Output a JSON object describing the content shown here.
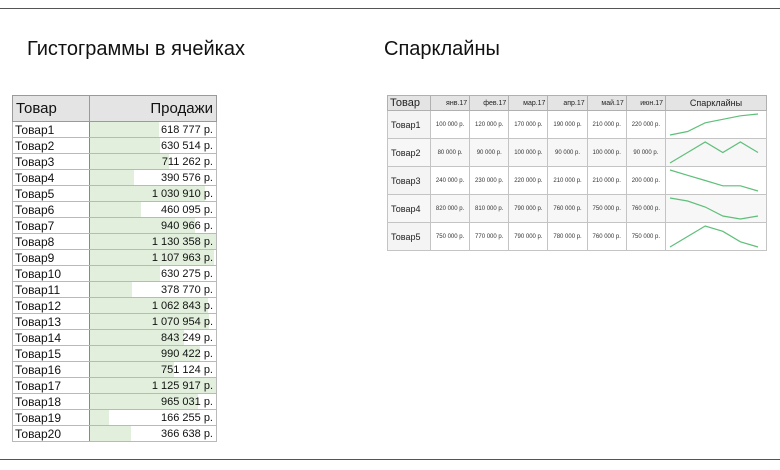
{
  "headings": {
    "left": "Гистограммы в ячейках",
    "right": "Спарклайны"
  },
  "colors": {
    "bar_fill": "#e1efdc",
    "spark_line": "#5fbf7a",
    "header_bg": "#e4e4e4"
  },
  "histogram": {
    "col_product": "Товар",
    "col_sales": "Продажи",
    "max_value": 1130358,
    "rows": [
      {
        "name": "Товар1",
        "text": "618 777 р.",
        "value": 618777
      },
      {
        "name": "Товар2",
        "text": "630 514 р.",
        "value": 630514
      },
      {
        "name": "Товар3",
        "text": "711 262 р.",
        "value": 711262
      },
      {
        "name": "Товар4",
        "text": "390 576 р.",
        "value": 390576
      },
      {
        "name": "Товар5",
        "text": "1 030 910 р.",
        "value": 1030910
      },
      {
        "name": "Товар6",
        "text": "460 095 р.",
        "value": 460095
      },
      {
        "name": "Товар7",
        "text": "940 966 р.",
        "value": 940966
      },
      {
        "name": "Товар8",
        "text": "1 130 358 р.",
        "value": 1130358
      },
      {
        "name": "Товар9",
        "text": "1 107 963 р.",
        "value": 1107963
      },
      {
        "name": "Товар10",
        "text": "630 275 р.",
        "value": 630275
      },
      {
        "name": "Товар11",
        "text": "378 770 р.",
        "value": 378770
      },
      {
        "name": "Товар12",
        "text": "1 062 843 р.",
        "value": 1062843
      },
      {
        "name": "Товар13",
        "text": "1 070 954 р.",
        "value": 1070954
      },
      {
        "name": "Товар14",
        "text": "843 249 р.",
        "value": 843249
      },
      {
        "name": "Товар15",
        "text": "990 422 р.",
        "value": 990422
      },
      {
        "name": "Товар16",
        "text": "751 124 р.",
        "value": 751124
      },
      {
        "name": "Товар17",
        "text": "1 125 917 р.",
        "value": 1125917
      },
      {
        "name": "Товар18",
        "text": "965 031 р.",
        "value": 965031
      },
      {
        "name": "Товар19",
        "text": "166 255 р.",
        "value": 166255
      },
      {
        "name": "Товар20",
        "text": "366 638 р.",
        "value": 366638
      }
    ]
  },
  "sparklines": {
    "col_product": "Товар",
    "col_spark": "Спарклайны",
    "months": [
      "янв.17",
      "фев.17",
      "мар.17",
      "апр.17",
      "май.17",
      "июн.17"
    ],
    "rows": [
      {
        "name": "Товар1",
        "texts": [
          "100 000 р.",
          "120 000 р.",
          "170 000 р.",
          "190 000 р.",
          "210 000 р.",
          "220 000 р."
        ],
        "values": [
          100000,
          120000,
          170000,
          190000,
          210000,
          220000
        ]
      },
      {
        "name": "Товар2",
        "texts": [
          "80 000 р.",
          "90 000 р.",
          "100 000 р.",
          "90 000 р.",
          "100 000 р.",
          "90 000 р."
        ],
        "values": [
          80000,
          90000,
          100000,
          90000,
          100000,
          90000
        ]
      },
      {
        "name": "Товар3",
        "texts": [
          "240 000 р.",
          "230 000 р.",
          "220 000 р.",
          "210 000 р.",
          "210 000 р.",
          "200 000 р."
        ],
        "values": [
          240000,
          230000,
          220000,
          210000,
          210000,
          200000
        ]
      },
      {
        "name": "Товар4",
        "texts": [
          "820 000 р.",
          "810 000 р.",
          "790 000 р.",
          "760 000 р.",
          "750 000 р.",
          "760 000 р."
        ],
        "values": [
          820000,
          810000,
          790000,
          760000,
          750000,
          760000
        ]
      },
      {
        "name": "Товар5",
        "texts": [
          "750 000 р.",
          "770 000 р.",
          "790 000 р.",
          "780 000 р.",
          "760 000 р.",
          "750 000 р."
        ],
        "values": [
          750000,
          770000,
          790000,
          780000,
          760000,
          750000
        ]
      }
    ]
  }
}
